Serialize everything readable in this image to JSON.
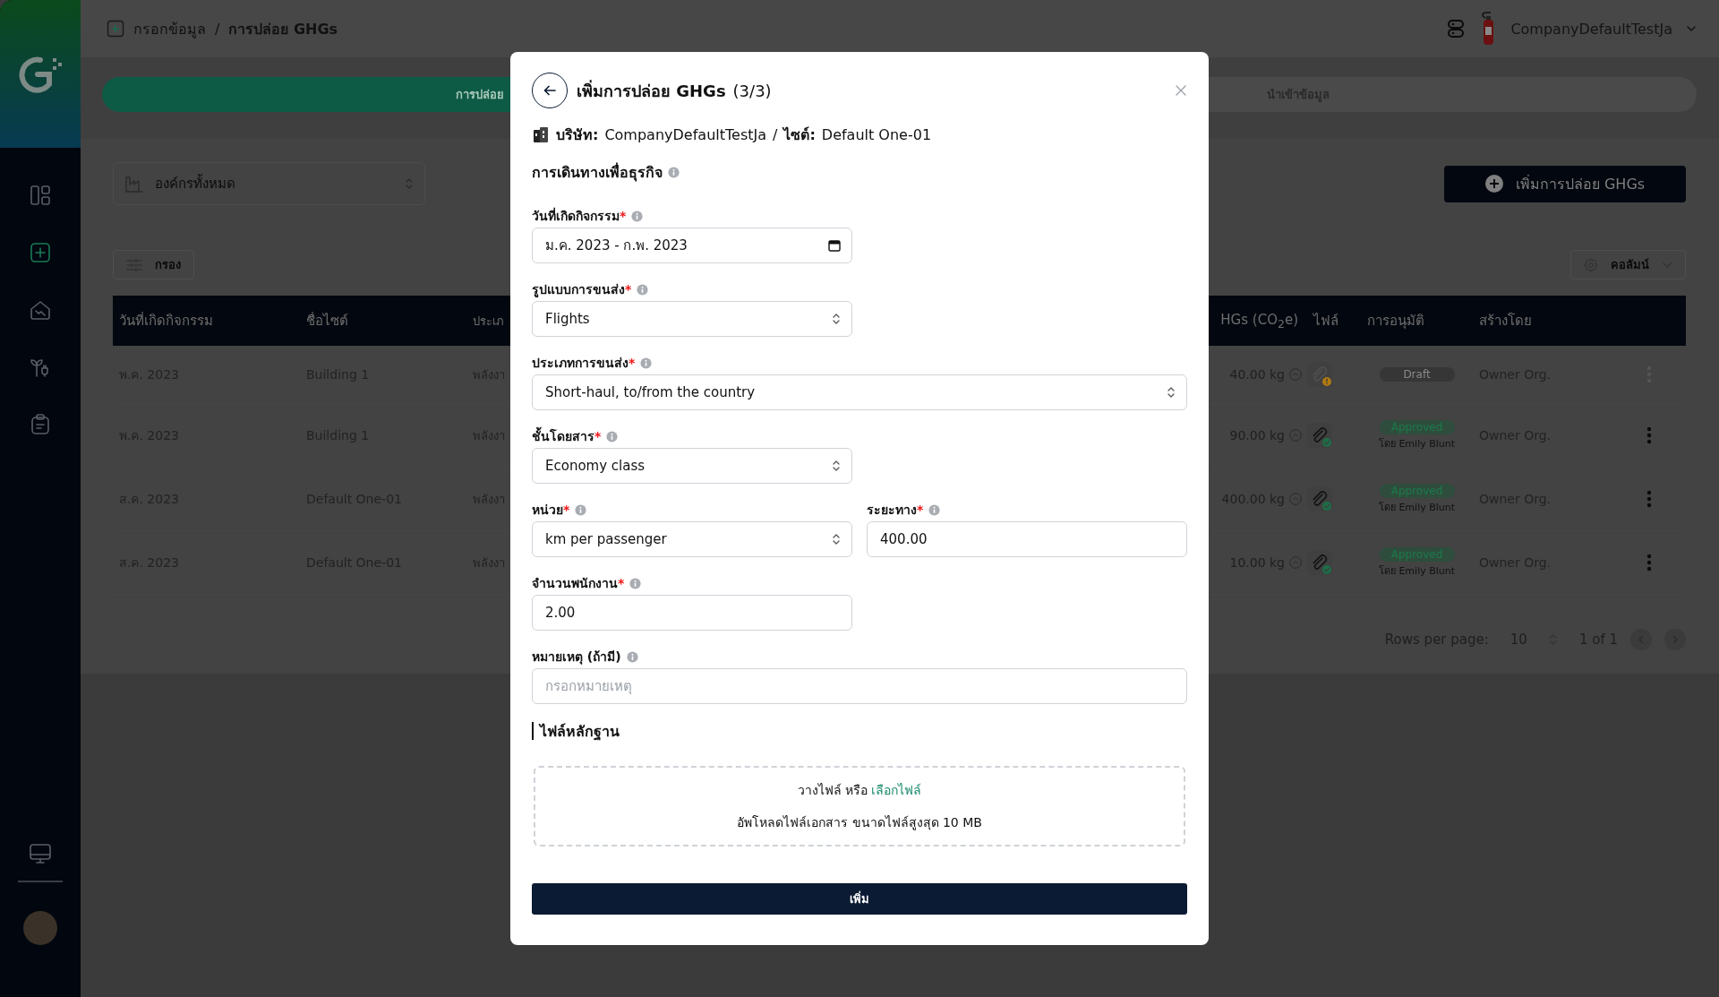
{
  "sidebar": {
    "items": [
      {
        "selected": false
      },
      {
        "selected": true
      },
      {
        "selected": false
      },
      {
        "selected": false
      },
      {
        "selected": false
      }
    ]
  },
  "breadcrumb": {
    "items": [
      "กรอกข้อมูล",
      "การปล่อย GHGs"
    ],
    "separator": "/"
  },
  "user": {
    "name": "CompanyDefaultTestJa"
  },
  "tabs": [
    {
      "label": "การปล่อย",
      "selected": true
    },
    {
      "label": "นำเข้าข้อมูล",
      "selected": false
    }
  ],
  "org_select": {
    "value": "องค์กรทั้งหมด"
  },
  "add_button": "เพิ่มการปล่อย GHGs",
  "filter_button": "กรอง",
  "columns_button": "คอลัมน์",
  "table": {
    "columns": [
      "วันที่เกิดกิจกรรม",
      "ชื่อไซต์",
      "ประเภ",
      "HGs (CO$_{2}$e)",
      "ไฟล์",
      "การอนุมัติ",
      "สร้างโดย"
    ],
    "rows": [
      {
        "date": "พ.ค. 2023",
        "site": "Building 1",
        "type": "พลังงา",
        "ghgs": "40.00 kg",
        "file_verified": false,
        "approval": {
          "kind": "draft",
          "status": "Draft"
        },
        "created_by": "Owner Org.",
        "menu_disabled": true
      },
      {
        "date": "พ.ค. 2023",
        "site": "Building 1",
        "type": "พลังงา",
        "ghgs": "90.00 kg",
        "file_verified": true,
        "approval": {
          "kind": "approved",
          "status": "Approved",
          "by": "โดย Emily Blunt"
        },
        "created_by": "Owner Org.",
        "menu_disabled": false
      },
      {
        "date": "ส.ค. 2023",
        "site": "Default One-01",
        "type": "พลังงา",
        "ghgs": "400.00 kg",
        "file_verified": true,
        "approval": {
          "kind": "approved",
          "status": "Approved",
          "by": "โดย Emily Blunt"
        },
        "created_by": "Owner Org.",
        "menu_disabled": false
      },
      {
        "date": "ส.ค. 2023",
        "site": "Default One-01",
        "type": "พลังงา",
        "ghgs": "10.00 kg",
        "file_verified": true,
        "approval": {
          "kind": "approved",
          "status": "Approved",
          "by": "โดย Emily Blunt"
        },
        "created_by": "Owner Org.",
        "menu_disabled": false
      }
    ]
  },
  "pagination": {
    "label": "Rows per page:",
    "rows_per_page": "10",
    "range": "1 of 1"
  },
  "modal": {
    "title": "เพิ่มการปล่อย GHGs",
    "step": "(3/3)",
    "company_label": "บริษัท:",
    "company": "CompanyDefaultTestJa",
    "separator": "/",
    "site_label": "ไซต์:",
    "site": "Default One-01",
    "section": "การเดินทางเพื่อธุรกิจ",
    "rows": [
      [
        {
          "kind": "date",
          "label": "วันที่เกิดกิจกรรม",
          "required_mark": "*",
          "value": "ม.ค. 2023 - ก.พ. 2023",
          "wide": false
        }
      ],
      [
        {
          "kind": "select",
          "label": "รูปแบบการขนส่ง",
          "required_mark": "*",
          "value": "Flights",
          "wide": false
        }
      ],
      [
        {
          "kind": "select",
          "label": "ประเภทการขนส่ง",
          "required_mark": "*",
          "value": "Short-haul, to/from the country",
          "wide": true
        }
      ],
      [
        {
          "kind": "select",
          "label": "ชั้นโดยสาร",
          "required_mark": "*",
          "value": "Economy class",
          "wide": false
        }
      ],
      [
        {
          "kind": "select",
          "label": "หน่วย",
          "required_mark": "*",
          "value": "km per passenger",
          "wide": false
        },
        {
          "kind": "text",
          "label": "ระยะทาง",
          "required_mark": "*",
          "value": "400.00",
          "wide": false
        }
      ],
      [
        {
          "kind": "text",
          "label": "จำนวนพนักงาน",
          "required_mark": "*",
          "value": "2.00",
          "wide": false
        }
      ],
      [
        {
          "kind": "text",
          "label": "หมายเหตุ (ถ้ามี)",
          "placeholder": "กรอกหมายเหตุ",
          "wide": true
        }
      ]
    ],
    "evidence": {
      "title": "ไฟล์หลักฐาน",
      "drop_text": "วางไฟล์ หรือ",
      "browse_link": "เลือกไฟล์",
      "hint": "อัพโหลดไฟล์เอกสาร ขนาดไฟล์สูงสุด 10 MB"
    },
    "submit": "เพิ่ม"
  }
}
